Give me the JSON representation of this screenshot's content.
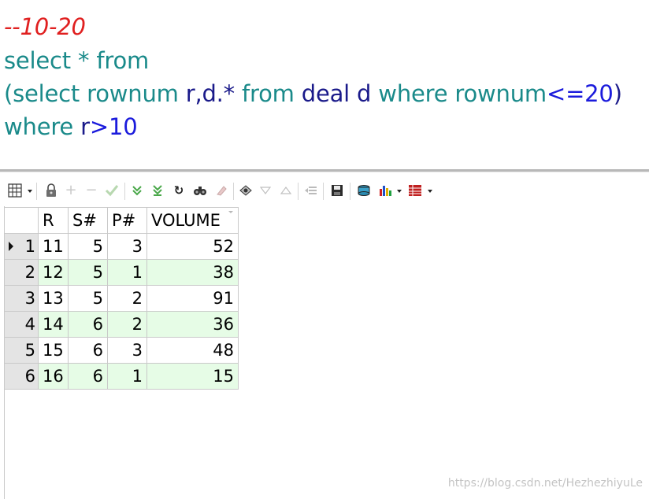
{
  "editor": {
    "line1_comment": "--10-20",
    "line2": {
      "kw_select": "select",
      "star": "*",
      "kw_from": "from"
    },
    "line3": {
      "lparen": "(",
      "kw_select": "select",
      "kw_rownum": "rownum",
      "ident_r_d": "r,d.*",
      "kw_from": "from",
      "ident_deal_d": "deal d",
      "kw_where": "where",
      "kw_rownum2": "rownum",
      "op_le": "<=",
      "num_20": "20",
      "rparen": ")"
    },
    "line4": {
      "kw_where": "where",
      "ident_r": "r",
      "op_gt": ">",
      "num_10": "10"
    }
  },
  "toolbar": {
    "icons": [
      "grid-menu-icon",
      "lock-icon",
      "add-record-icon",
      "delete-record-icon",
      "post-changes-icon",
      "fetch-next-icon",
      "fetch-last-icon",
      "refresh-icon",
      "find-icon",
      "clear-icon",
      "query-by-example-icon",
      "filter-icon",
      "sort-icon",
      "export-icon",
      "save-icon",
      "print-icon",
      "chart-icon",
      "grid-view-icon"
    ]
  },
  "grid": {
    "columns": [
      "R",
      "S#",
      "P#",
      "VOLUME"
    ],
    "rows": [
      {
        "num": "1",
        "R": "11",
        "S": "5",
        "P": "3",
        "VOLUME": "52"
      },
      {
        "num": "2",
        "R": "12",
        "S": "5",
        "P": "1",
        "VOLUME": "38"
      },
      {
        "num": "3",
        "R": "13",
        "S": "5",
        "P": "2",
        "VOLUME": "91"
      },
      {
        "num": "4",
        "R": "14",
        "S": "6",
        "P": "2",
        "VOLUME": "36"
      },
      {
        "num": "5",
        "R": "15",
        "S": "6",
        "P": "3",
        "VOLUME": "48"
      },
      {
        "num": "6",
        "R": "16",
        "S": "6",
        "P": "1",
        "VOLUME": "15"
      }
    ]
  },
  "watermark": "https://blog.csdn.net/HezhezhiyuLe",
  "colors": {
    "comment": "#e02020",
    "keyword": "#1a8a8a",
    "identifier": "#1a1a8a",
    "number": "#1b1bdc",
    "even_row": "#e6fce6",
    "row_header": "#e4e4e4"
  }
}
